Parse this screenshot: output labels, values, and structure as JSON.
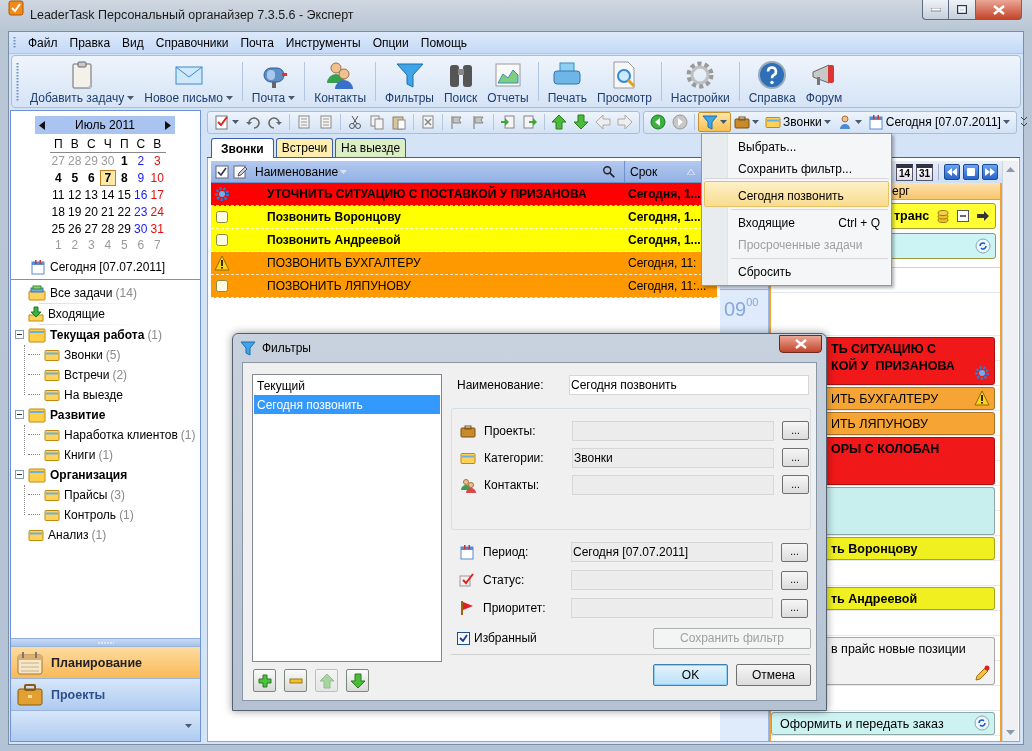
{
  "window": {
    "title": "LeaderTask Персональный органайзер 7.3.5.6 - Эксперт"
  },
  "menu_bar": [
    "Файл",
    "Правка",
    "Вид",
    "Справочники",
    "Почта",
    "Инструменты",
    "Опции",
    "Помощь"
  ],
  "toolbar": {
    "groups": [
      {
        "buttons": [
          {
            "label": "Добавить задачу",
            "dropdown": true
          },
          {
            "label": "Новое письмо",
            "dropdown": true
          }
        ]
      },
      {
        "buttons": [
          {
            "label": "Почта",
            "dropdown": true
          }
        ]
      },
      {
        "buttons": [
          {
            "label": "Контакты",
            "dropdown": false
          }
        ]
      },
      {
        "buttons": [
          {
            "label": "Фильтры",
            "dropdown": false
          },
          {
            "label": "Поиск",
            "dropdown": false
          },
          {
            "label": "Отчеты",
            "dropdown": false
          }
        ]
      },
      {
        "buttons": [
          {
            "label": "Печать",
            "dropdown": false
          },
          {
            "label": "Просмотр",
            "dropdown": false
          }
        ]
      },
      {
        "buttons": [
          {
            "label": "Настройки",
            "dropdown": false
          }
        ]
      },
      {
        "buttons": [
          {
            "label": "Справка",
            "dropdown": false
          },
          {
            "label": "Форум",
            "dropdown": false
          }
        ]
      }
    ]
  },
  "sidebar": {
    "calendar": {
      "month": "Июль 2011",
      "weekdays": [
        "П",
        "В",
        "С",
        "Ч",
        "П",
        "С",
        "В"
      ],
      "weeks": [
        [
          {
            "text": "27",
            "in_month": false,
            "bold": false,
            "selected": false
          },
          {
            "text": "28",
            "in_month": false,
            "bold": false,
            "selected": false
          },
          {
            "text": "29",
            "in_month": false,
            "bold": false,
            "selected": false
          },
          {
            "text": "30",
            "in_month": false,
            "bold": false,
            "selected": false
          },
          {
            "text": "1",
            "in_month": true,
            "bold": true,
            "selected": false
          },
          {
            "text": "2",
            "in_month": true,
            "bold": false,
            "selected": false
          },
          {
            "text": "3",
            "in_month": true,
            "bold": false,
            "selected": false
          }
        ],
        [
          {
            "text": "4",
            "in_month": true,
            "bold": true,
            "selected": false
          },
          {
            "text": "5",
            "in_month": true,
            "bold": true,
            "selected": false
          },
          {
            "text": "6",
            "in_month": true,
            "bold": true,
            "selected": false
          },
          {
            "text": "7",
            "in_month": true,
            "bold": true,
            "selected": true
          },
          {
            "text": "8",
            "in_month": true,
            "bold": true,
            "selected": false
          },
          {
            "text": "9",
            "in_month": true,
            "bold": false,
            "selected": false
          },
          {
            "text": "10",
            "in_month": true,
            "bold": false,
            "selected": false
          }
        ],
        [
          {
            "text": "11",
            "in_month": true,
            "bold": false,
            "selected": false
          },
          {
            "text": "12",
            "in_month": true,
            "bold": false,
            "selected": false
          },
          {
            "text": "13",
            "in_month": true,
            "bold": false,
            "selected": false
          },
          {
            "text": "14",
            "in_month": true,
            "bold": false,
            "selected": false
          },
          {
            "text": "15",
            "in_month": true,
            "bold": false,
            "selected": false
          },
          {
            "text": "16",
            "in_month": true,
            "bold": false,
            "selected": false
          },
          {
            "text": "17",
            "in_month": true,
            "bold": false,
            "selected": false
          }
        ],
        [
          {
            "text": "18",
            "in_month": true,
            "bold": false,
            "selected": false
          },
          {
            "text": "19",
            "in_month": true,
            "bold": false,
            "selected": false
          },
          {
            "text": "20",
            "in_month": true,
            "bold": false,
            "selected": false
          },
          {
            "text": "21",
            "in_month": true,
            "bold": false,
            "selected": false
          },
          {
            "text": "22",
            "in_month": true,
            "bold": false,
            "selected": false
          },
          {
            "text": "23",
            "in_month": true,
            "bold": false,
            "selected": false
          },
          {
            "text": "24",
            "in_month": true,
            "bold": false,
            "selected": false
          }
        ],
        [
          {
            "text": "25",
            "in_month": true,
            "bold": false,
            "selected": false
          },
          {
            "text": "26",
            "in_month": true,
            "bold": false,
            "selected": false
          },
          {
            "text": "27",
            "in_month": true,
            "bold": false,
            "selected": false
          },
          {
            "text": "28",
            "in_month": true,
            "bold": false,
            "selected": false
          },
          {
            "text": "29",
            "in_month": true,
            "bold": false,
            "selected": false
          },
          {
            "text": "30",
            "in_month": true,
            "bold": false,
            "selected": false
          },
          {
            "text": "31",
            "in_month": true,
            "bold": false,
            "selected": false
          }
        ],
        [
          {
            "text": "1",
            "in_month": false,
            "bold": false,
            "selected": false
          },
          {
            "text": "2",
            "in_month": false,
            "bold": false,
            "selected": false
          },
          {
            "text": "3",
            "in_month": false,
            "bold": false,
            "selected": false
          },
          {
            "text": "4",
            "in_month": false,
            "bold": false,
            "selected": false
          },
          {
            "text": "5",
            "in_month": false,
            "bold": false,
            "selected": false
          },
          {
            "text": "6",
            "in_month": false,
            "bold": false,
            "selected": false
          },
          {
            "text": "7",
            "in_month": false,
            "bold": false,
            "selected": false
          }
        ]
      ]
    },
    "today": "Сегодня [07.07.2011]",
    "tree": [
      {
        "label": "Все задачи",
        "count": "(14)",
        "kind": "all"
      },
      {
        "label": "Входящие",
        "kind": "inbox"
      },
      {
        "label": "Текущая работа",
        "count": "(1)",
        "kind": "project",
        "expanded": true,
        "children": [
          {
            "label": "Звонки",
            "count": "(5)",
            "kind": "category"
          },
          {
            "label": "Встречи",
            "count": "(2)",
            "kind": "category"
          },
          {
            "label": "На выезде",
            "kind": "category"
          }
        ]
      },
      {
        "label": "Развитие",
        "kind": "project",
        "expanded": true,
        "children": [
          {
            "label": "Наработка клиентов",
            "count": "(1)",
            "kind": "category"
          },
          {
            "label": "Книги",
            "count": "(1)",
            "kind": "category"
          }
        ]
      },
      {
        "label": "Организация",
        "kind": "project",
        "expanded": true,
        "children": [
          {
            "label": "Прайсы",
            "count": "(3)",
            "kind": "category"
          },
          {
            "label": "Контроль",
            "count": "(1)",
            "kind": "category"
          }
        ]
      },
      {
        "label": "Анализ",
        "count": "(1)",
        "kind": "category"
      }
    ],
    "nav": [
      {
        "label": "Планирование",
        "selected": true
      },
      {
        "label": "Проекты",
        "selected": false
      }
    ]
  },
  "quick_toolbar": {
    "filter_pressed": true,
    "category": "Звонки",
    "period": "Сегодня [07.07.2011]"
  },
  "tabs": [
    {
      "label": "Звонки",
      "selected": true
    },
    {
      "label": "Встречи",
      "selected": false,
      "color": "#fdeeb0"
    },
    {
      "label": "На выезде",
      "selected": false,
      "color": "#dcefc4"
    }
  ],
  "task_table": {
    "columns": [
      "Наименование",
      "Срок"
    ],
    "rows": [
      {
        "title": "УТОЧНИТЬ СИТУАЦИЮ С ПОСТАВКОЙ У  ПРИЗАНОВА",
        "due": "Сегодня, 1...",
        "color": "#ff0000",
        "bold": true,
        "kind": "auto"
      },
      {
        "title": "Позвонить Воронцову",
        "due": "Сегодня, 1...",
        "color": "#ffff00",
        "bold": true,
        "kind": "task"
      },
      {
        "title": "Позвонить Андреевой",
        "due": "Сегодня, 1...",
        "color": "#ffff00",
        "bold": true,
        "kind": "task"
      },
      {
        "title": "ПОЗВОНИТЬ БУХГАЛТЕРУ",
        "due": "Сегодня, 11:",
        "color": "#ff9900",
        "bold": false,
        "kind": "alert"
      },
      {
        "title": "ПОЗВОНИТЬ ЛЯПУНОВУ",
        "due": "Сегодня, 11:...",
        "color": "#ff9900",
        "bold": false,
        "kind": "task"
      }
    ]
  },
  "filter_menu": {
    "items": [
      {
        "label": "Выбрать...",
        "selected": false,
        "disabled": false,
        "separator_before": false
      },
      {
        "label": "Сохранить фильтр...",
        "selected": false,
        "disabled": false,
        "separator_before": false
      },
      {
        "label": "Сегодня позвонить",
        "selected": true,
        "disabled": false,
        "separator_before": true
      },
      {
        "label": "Входящие",
        "shortcut": "Ctrl + Q",
        "selected": false,
        "disabled": false,
        "separator_before": true
      },
      {
        "label": "Просроченные задачи",
        "selected": false,
        "disabled": true,
        "separator_before": false
      },
      {
        "label": "Сбросить",
        "selected": false,
        "disabled": false,
        "separator_before": true
      }
    ]
  },
  "day_view": {
    "view_buttons": [
      "14",
      "31"
    ],
    "day_header": "ерг",
    "all_day": [
      {
        "title": "транс",
        "color": "#ffff33",
        "kind": "task"
      },
      {
        "color": "#ccf4f4",
        "kind": "recurring"
      }
    ],
    "time_label": "09$^{00}$",
    "events": [
      {
        "kind": "free"
      },
      {
        "title": "ТЬ СИТУАЦИЮ С\nКОЙ У  ПРИЗАНОВА",
        "color": "#f01818",
        "bold": true,
        "tall": true,
        "covered": true,
        "kind": "auto"
      },
      {
        "title": "ИТЬ БУХГАЛТЕРУ",
        "color": "#f6a535",
        "bold": false,
        "tall": false,
        "covered": true,
        "kind": "alert"
      },
      {
        "title": "ИТЬ ЛЯПУНОВУ",
        "color": "#f6a535",
        "bold": false,
        "tall": false,
        "covered": true,
        "kind": "plain"
      },
      {
        "title": "ОРЫ С КОЛОБАН",
        "color": "#f01818",
        "bold": true,
        "tall": true,
        "covered": true,
        "kind": "plain"
      },
      {
        "color": "#c8eeee",
        "tall": true,
        "kind": "plain"
      },
      {
        "title": "ть Воронцову",
        "color": "#f0f020",
        "bold": true,
        "tall": false,
        "covered": true,
        "kind": "plain"
      },
      {
        "kind": "free"
      },
      {
        "title": "ть Андреевой",
        "color": "#f0f020",
        "bold": true,
        "tall": false,
        "covered": true,
        "kind": "plain"
      },
      {
        "kind": "free"
      },
      {
        "title": "в прайс новые позиции",
        "color": "#f2f2f2",
        "bold": false,
        "tall": true,
        "covered": true,
        "kind": "note"
      },
      {
        "kind": "free"
      },
      {
        "title": "Оформить и передать заказ",
        "color": "#cdf2f2",
        "bold": false,
        "tall": false,
        "covered": false,
        "kind": "recurring"
      }
    ]
  },
  "filter_dialog": {
    "title": "Фильтры",
    "filters": [
      {
        "label": "Текущий",
        "selected": false
      },
      {
        "label": "Сегодня позвонить",
        "selected": true
      }
    ],
    "list_buttons": [
      {
        "kind": "add",
        "disabled": false
      },
      {
        "kind": "remove",
        "disabled": false
      },
      {
        "kind": "up",
        "disabled": true
      },
      {
        "kind": "down",
        "disabled": false
      }
    ],
    "name": {
      "label": "Наименование:",
      "value": "Сегодня позвонить"
    },
    "criteria": [
      {
        "label": "Проекты:",
        "button": "..."
      },
      {
        "label": "Категории:",
        "value": "Звонки",
        "button": "..."
      },
      {
        "label": "Контакты:",
        "button": "..."
      }
    ],
    "period_fields": [
      {
        "label": "Период:",
        "value": "Сегодня [07.07.2011]",
        "button": "..."
      },
      {
        "label": "Статус:",
        "button": "..."
      },
      {
        "label": "Приоритет:",
        "button": "..."
      }
    ],
    "favorite": {
      "label": "Избранный",
      "checked": true
    },
    "save_button": {
      "label": "Сохранить фильтр",
      "disabled": true
    },
    "buttons": [
      {
        "label": "OK",
        "focused": true
      },
      {
        "label": "Отмена",
        "focused": false
      }
    ]
  }
}
